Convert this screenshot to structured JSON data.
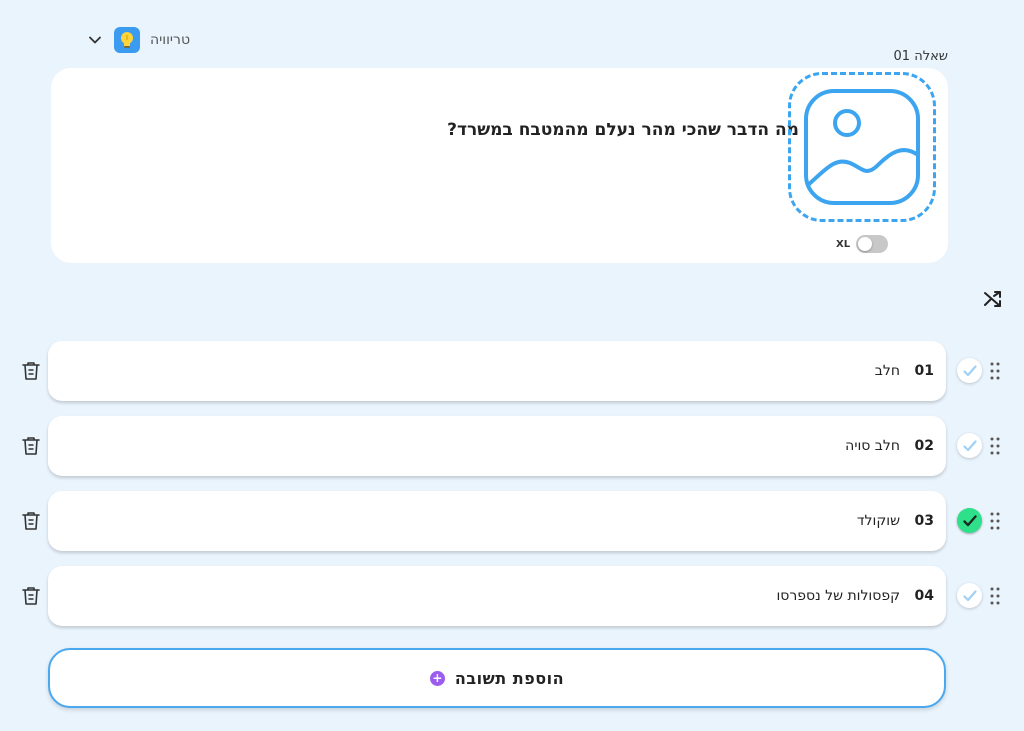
{
  "question_type": {
    "label": "טריוויה",
    "icon": "lightbulb-icon"
  },
  "question": {
    "number_label": "שאלה 01",
    "text": "מה הדבר שהכי מהר נעלם מהמטבח במשרד?",
    "image_placeholder_icon": "image-placeholder-icon",
    "xl_label": "XL",
    "xl_enabled": false
  },
  "answers": [
    {
      "num": "01",
      "text": "חלב",
      "correct": false
    },
    {
      "num": "02",
      "text": "חלב סויה",
      "correct": false
    },
    {
      "num": "03",
      "text": "שוקולד",
      "correct": true
    },
    {
      "num": "04",
      "text": "קפסולות של נספרסו",
      "correct": false
    }
  ],
  "add_answer": {
    "label": "הוספת תשובה"
  },
  "colors": {
    "background": "#eaf4fd",
    "accent_blue": "#3da5f0",
    "correct_green": "#2fe08a",
    "plus_purple": "#9b5cf0"
  }
}
